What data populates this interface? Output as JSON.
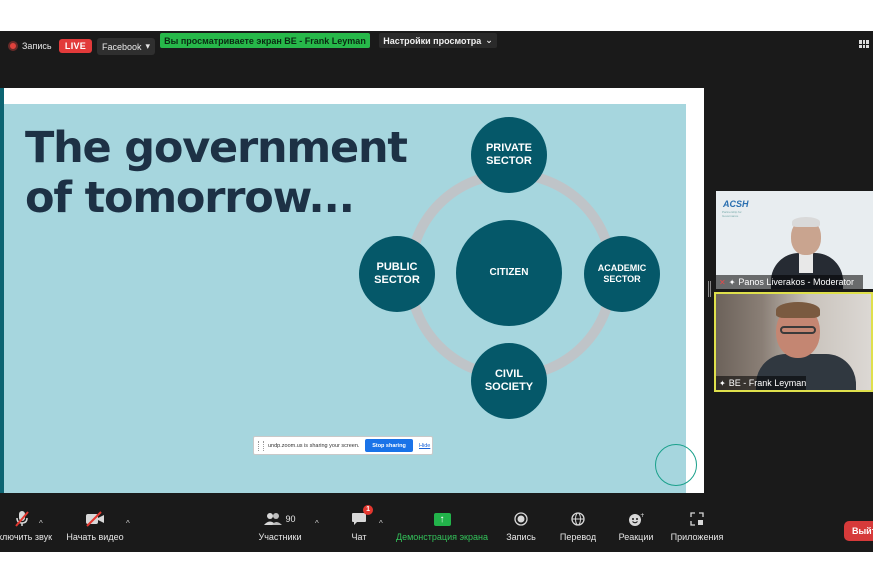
{
  "top_bar": {
    "recording_label": "Запись",
    "live_badge": "LIVE",
    "live_platform": "Facebook",
    "viewing_banner": "Вы просматриваете экран BE - Frank Leyman",
    "view_options": "Настройки просмотра"
  },
  "slide": {
    "title_line1": "The government",
    "title_line2": "of tomorrow...",
    "diagram": {
      "center": "CITIZEN",
      "nodes": {
        "top_line1": "PRIVATE",
        "top_line2": "SECTOR",
        "left_line1": "PUBLIC",
        "left_line2": "SECTOR",
        "right_line1": "ACADEMIC",
        "right_line2": "SECTOR",
        "bottom_line1": "CIVIL",
        "bottom_line2": "SOCIETY"
      }
    }
  },
  "share_banner": {
    "message": "undp.zoom.us is sharing your screen.",
    "stop_label": "Stop sharing",
    "hide_label": "Hide"
  },
  "participants": [
    {
      "name": "Panos Liverakos - Moderator",
      "logo_text": "ACSH",
      "logo_tagline": "Partnership for Governance",
      "muted": true
    },
    {
      "name": "BE - Frank Leyman",
      "active_speaker": true
    }
  ],
  "toolbar": {
    "audio_label": "Включить звук",
    "video_label": "Начать видео",
    "participants_label": "Участники",
    "participants_count": "90",
    "chat_label": "Чат",
    "chat_badge": "1",
    "share_label": "Демонстрация экрана",
    "record_label": "Запись",
    "translate_label": "Перевод",
    "reactions_label": "Реакции",
    "apps_label": "Приложения",
    "end_label": "Выйти"
  },
  "colors": {
    "slide_bg": "#a6d6de",
    "node": "#055869",
    "title": "#1d3145",
    "share_green": "#22b34a",
    "live_red": "#e23a3a",
    "end_red": "#d63a3a"
  }
}
